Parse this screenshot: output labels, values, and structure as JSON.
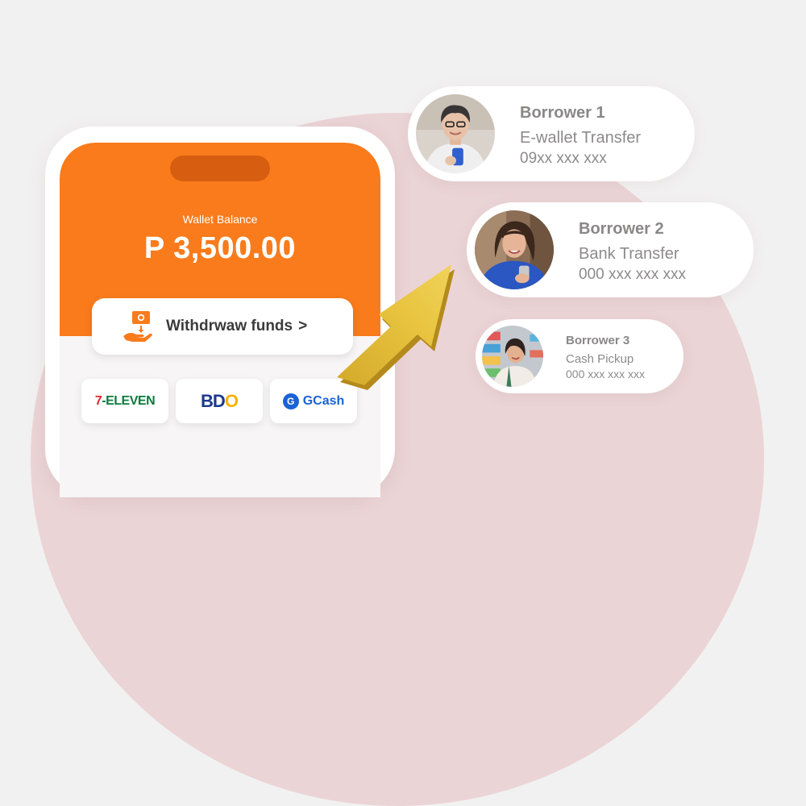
{
  "wallet": {
    "label": "Wallet Balance",
    "amount": "P 3,500.00"
  },
  "withdraw": {
    "label": "Withdrwaw funds",
    "chevron": ">"
  },
  "partners": [
    {
      "seven": "7",
      "rest": "-ELEVEN"
    },
    {
      "bd": "BD",
      "o": "O"
    },
    {
      "mark": "G",
      "name": "GCash"
    }
  ],
  "borrowers": [
    {
      "name": "Borrower 1",
      "method": "E-wallet Transfer",
      "account": "09xx xxx xxx"
    },
    {
      "name": "Borrower 2",
      "method": "Bank Transfer",
      "account": "000 xxx xxx xxx"
    },
    {
      "name": "Borrower 3",
      "method": "Cash Pickup",
      "account": "000 xxx xxx xxx"
    }
  ],
  "colors": {
    "primary": "#f97b1c",
    "notch": "#d75e10",
    "background": "#f2f1f1",
    "arc": "#ebd4d6",
    "arrow": "#e6c03c",
    "card_text": "#8d8a8a"
  },
  "icons": {
    "withdraw": "hand-money-icon",
    "arrow": "arrow-up-right-icon"
  }
}
